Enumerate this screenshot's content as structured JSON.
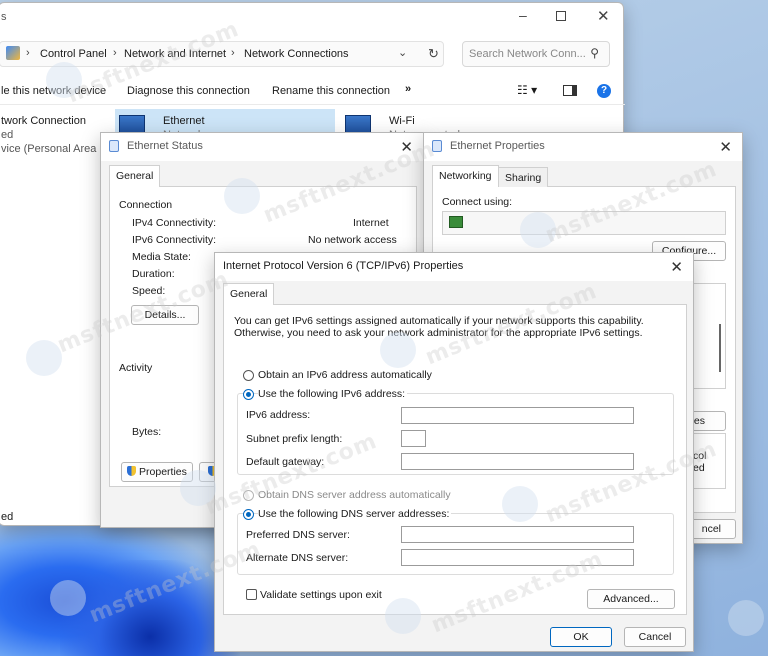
{
  "explorer": {
    "address": {
      "crumbs": [
        "Control Panel",
        "Network and Internet",
        "Network Connections"
      ],
      "search_placeholder": "Search Network Conn..."
    },
    "commands": [
      "le this network device",
      "Diagnose this connection",
      "Rename this connection",
      "»"
    ],
    "left_items": [
      "twork Connection",
      "ed",
      "vice (Personal Area ..."
    ],
    "status_bottom": "ed",
    "items": [
      {
        "name": "Ethernet",
        "status": "Network"
      },
      {
        "name": "Wi-Fi",
        "status": "Not connected"
      }
    ]
  },
  "eth_status": {
    "title": "Ethernet Status",
    "tab": "General",
    "connection_heading": "Connection",
    "rows": [
      {
        "label": "IPv4 Connectivity:",
        "value": "Internet"
      },
      {
        "label": "IPv6 Connectivity:",
        "value": "No network access"
      },
      {
        "label": "Media State:",
        "value": ""
      },
      {
        "label": "Duration:",
        "value": ""
      },
      {
        "label": "Speed:",
        "value": ""
      }
    ],
    "details_btn": "Details...",
    "activity_heading": "Activity",
    "bytes_label": "Bytes:",
    "properties_btn": "Properties"
  },
  "eth_props": {
    "title": "Ethernet Properties",
    "tabs": [
      "Networking",
      "Sharing"
    ],
    "connect_using": "Connect using:",
    "configure_btn": "Configure...",
    "partial_es": "es",
    "partial_col": "col",
    "partial_ed": "ed",
    "cancel_partial": "ncel"
  },
  "ipv6": {
    "title": "Internet Protocol Version 6 (TCP/IPv6) Properties",
    "tab": "General",
    "description_line1": "You can get IPv6 settings assigned automatically if your network supports this capability.",
    "description_line2": "Otherwise, you need to ask your network administrator for the appropriate IPv6 settings.",
    "opt_auto_ip": "Obtain an IPv6 address automatically",
    "opt_manual_ip": "Use the following IPv6 address:",
    "ipv6_address_label": "IPv6 address:",
    "subnet_label": "Subnet prefix length:",
    "gateway_label": "Default gateway:",
    "opt_auto_dns": "Obtain DNS server address automatically",
    "opt_manual_dns": "Use the following DNS server addresses:",
    "preferred_dns_label": "Preferred DNS server:",
    "alternate_dns_label": "Alternate DNS server:",
    "validate_label": "Validate settings upon exit",
    "advanced_btn": "Advanced...",
    "ok_btn": "OK",
    "cancel_btn": "Cancel"
  },
  "watermark_text": "msftnext.com",
  "colors": {
    "accent": "#0067c0",
    "help_blue": "#1a73e8"
  }
}
